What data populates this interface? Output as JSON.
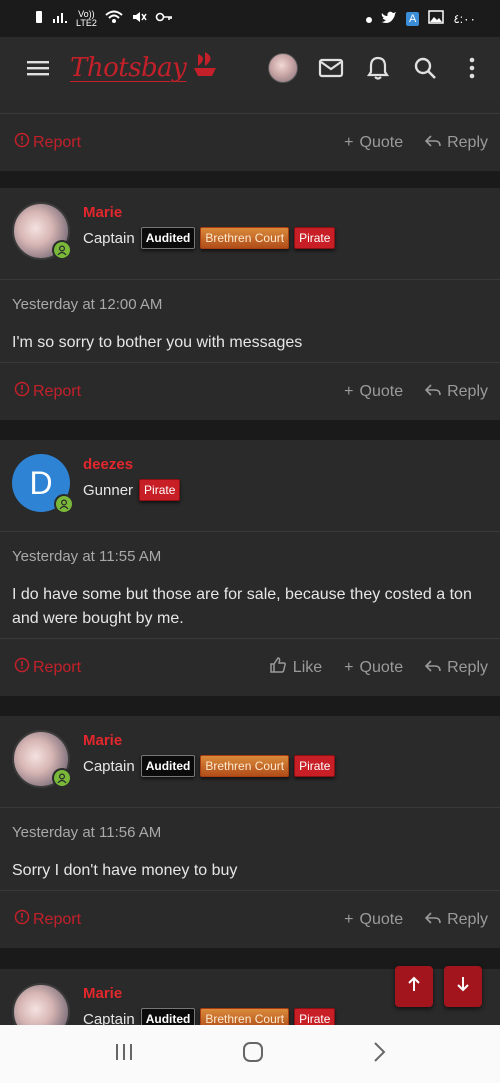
{
  "status_bar": {
    "network": "Vo))",
    "network_sub": "LTE2",
    "time": "٤:٠٠"
  },
  "nav": {
    "logo_text": "Thotsbay"
  },
  "posts": [
    {
      "username": "Marie",
      "user_title": "Captain",
      "badges": [
        "Audited",
        "Brethren Court",
        "Pirate"
      ],
      "time": "Yesterday at 12:00 AM",
      "body": "I'm so sorry to bother you with messages"
    },
    {
      "username": "deezes",
      "avatar_letter": "D",
      "user_title": "Gunner",
      "badges": [
        "Pirate"
      ],
      "time": "Yesterday at 11:55 AM",
      "body": "I do have some but those are for sale, because they costed a ton and were bought by me."
    },
    {
      "username": "Marie",
      "user_title": "Captain",
      "badges": [
        "Audited",
        "Brethren Court",
        "Pirate"
      ],
      "time": "Yesterday at 11:56 AM",
      "body": "Sorry I don't have money to buy"
    },
    {
      "username": "Marie",
      "user_title": "Captain",
      "badges": [
        "Audited",
        "Brethren Court",
        "Pirate"
      ]
    }
  ],
  "actions": {
    "report": "Report",
    "like": "Like",
    "quote": "Quote",
    "reply": "Reply"
  },
  "colors": {
    "accent": "#c4202a",
    "background": "#1a1a1a",
    "card": "#2a2a2a",
    "online": "#7ab83a"
  }
}
